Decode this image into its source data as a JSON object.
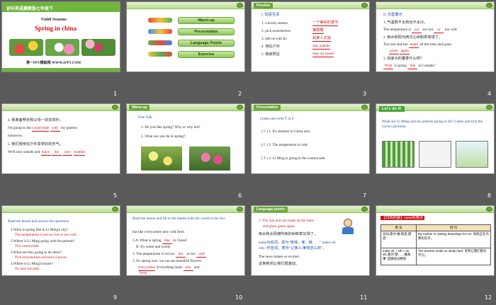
{
  "slides": [
    {
      "number": "1",
      "banner": "初中英语冀教版七年级下",
      "unit": "Unit6  Seasons",
      "title": "Spring in china",
      "footer": "第一PPT模板网-WWW.1PPT.COM"
    },
    {
      "number": "2",
      "menu": [
        "Warm-up",
        "Presentation",
        "Language Points",
        "Exercise"
      ]
    },
    {
      "number": "3",
      "tag": "Preview",
      "heading": "I. 短语互译",
      "items": [
        "1. a lovely season",
        "2. pick strawberries",
        "3. talk to/with sb.",
        "4. 待在户外",
        "5. 我家附近"
      ],
      "answers": [
        "一个美好的季节",
        "摘草莓",
        "和某人交谈",
        "stay outside",
        "near my house"
      ]
    },
    {
      "number": "4",
      "heading": "II. 句型展示",
      "lines": [
        "1. 气温既不太热也不太冷。",
        "The temperature is",
        "too hot",
        "too cold.",
        "2. 雨水和阳光两次让树和草变绿了。",
        "The rain and sun",
        "all the trees and grass",
        "3. 加拿大的春季什么样？",
        "is spring",
        "in Canada?"
      ],
      "answers": [
        "not",
        "or",
        "make",
        "green",
        "again",
        "What",
        "like"
      ]
    },
    {
      "number": "5",
      "lines": [
        "4. 我准备明天和父母一块去郊外。",
        "I'm going to the",
        "my parents",
        "tomorrow.",
        "5. 我们将待在户外享受好的天气。",
        "We'll stay outside and",
        "."
      ],
      "answers": [
        "countryside",
        "with",
        "enjoy",
        "the",
        "nice",
        "weather"
      ]
    },
    {
      "number": "6",
      "tag": "Warm-up",
      "heading": "Free Talk",
      "questions": [
        "1. Do you like spring? Why or why not?",
        "2. What can you do in spring?"
      ]
    },
    {
      "number": "7",
      "tag": "Presentation",
      "heading": "Listen and write T or F.",
      "items": [
        {
          "mark": "F",
          "text": "1. It's summer in China now."
        },
        {
          "mark": "F",
          "text": "2. The temperature is cold."
        },
        {
          "mark": "T",
          "text": "3. Li Ming is going to the countryside."
        }
      ]
    },
    {
      "number": "8",
      "tag": "Let's do it!",
      "question": "What are Li Ming and his parents going to do? Listen and tick the correct pictures."
    },
    {
      "number": "9",
      "heading": "Read the lesson and answer the questions.",
      "qa": [
        {
          "q": "1.What is spring like in Li Ming's city?",
          "a": "The temperature is not too hot or too cold."
        },
        {
          "q": "2.Where is Li Ming going with his parents?",
          "a": "The countryside."
        },
        {
          "q": "3.What are they going to do there?",
          "a": "Pick strawberries and have a picnic."
        },
        {
          "q": "4.Where is Li Ming's house?",
          "a": "It's near the park."
        }
      ]
    },
    {
      "number": "10",
      "heading": "Read the lesson and fill in the blanks with the words in the box.",
      "wordbox": "hot   like   everywhere   new   cold   fresh",
      "lines": [
        "1.A: What is spring",
        "in China?",
        "B: It's warm and windy.",
        "2. The temperature is not too",
        "or too",
        "3. It's spring now. we can see beautiful flowers",
        ". Everything looks",
        "and"
      ],
      "answers": [
        "like",
        "hot",
        "cold",
        "everywhere",
        "new",
        "fresh"
      ]
    },
    {
      "number": "11",
      "tag": "Language points",
      "lines": [
        "1. The rain and sun make all the trees",
        "and grass green again.",
        "雨水和太阳使所有的树和草又绿了。",
        "make为动词，意为“使得，使…做……” make+sb",
        "/sth.+形容词，表示“让某人/某物怎么样”。",
        "The news makes us excited.",
        "这条新闻让我们很激动。"
      ]
    },
    {
      "number": "12",
      "heading": "【归纳拓展】make的用法",
      "table": {
        "headers": [
          "用  法",
          "例  句"
        ],
        "rows": [
          [
            "动词,意为“做,制造,建造”",
            "My mother is making dumplings for me. 妈妈正在为我包饺子。"
          ],
          [
            "make sb. / sth.+ do sth.意为“使……做某事”,后跟动词原形",
            "The teacher made us study hard. 老师让我们努力学习。"
          ]
        ]
      }
    }
  ]
}
